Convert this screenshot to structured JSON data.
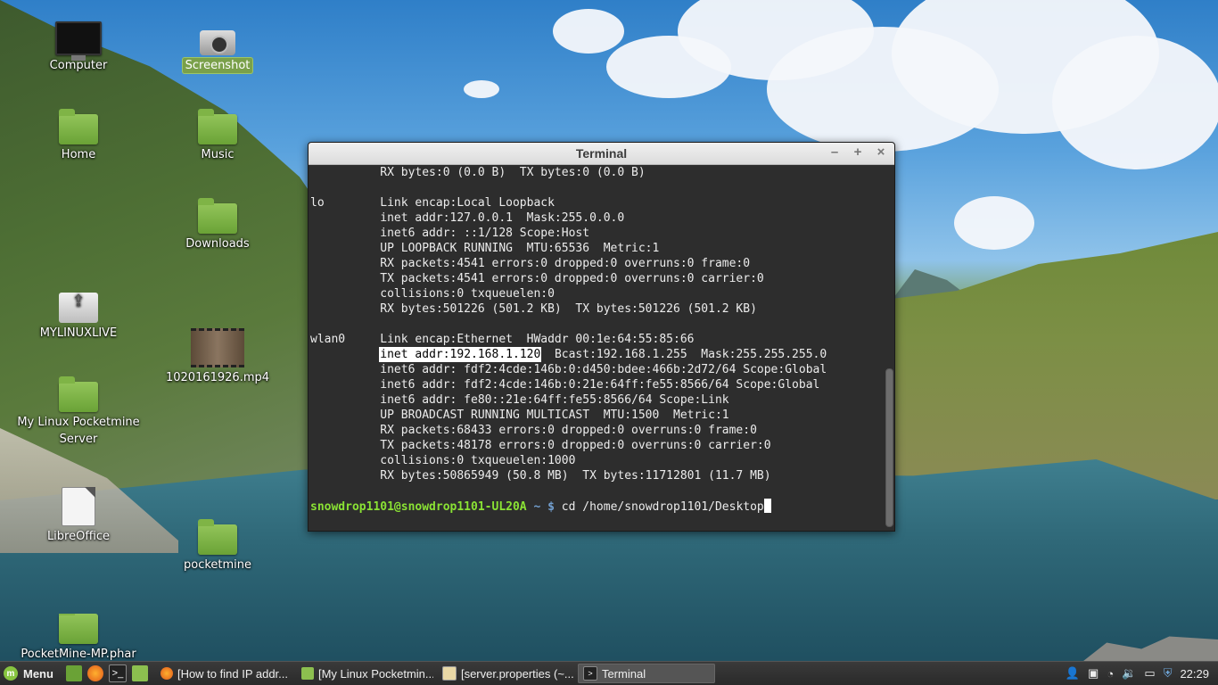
{
  "desktop": {
    "icons": [
      {
        "label": "Computer"
      },
      {
        "label": "Screenshot"
      },
      {
        "label": "Home"
      },
      {
        "label": "Music"
      },
      {
        "label": "Downloads"
      },
      {
        "label": "MYLINUXLIVE"
      },
      {
        "label": "1020161926.mp4"
      },
      {
        "label": "My Linux Pocketmine Server"
      },
      {
        "label": "LibreOffice"
      },
      {
        "label": "pocketmine"
      },
      {
        "label": "PocketMine-MP.phar"
      }
    ]
  },
  "terminal": {
    "title": "Terminal",
    "controls": {
      "minimize": "–",
      "maximize": "+",
      "close": "×"
    },
    "lines": [
      "          RX bytes:0 (0.0 B)  TX bytes:0 (0.0 B)",
      "",
      "lo        Link encap:Local Loopback",
      "          inet addr:127.0.0.1  Mask:255.0.0.0",
      "          inet6 addr: ::1/128 Scope:Host",
      "          UP LOOPBACK RUNNING  MTU:65536  Metric:1",
      "          RX packets:4541 errors:0 dropped:0 overruns:0 frame:0",
      "          TX packets:4541 errors:0 dropped:0 overruns:0 carrier:0",
      "          collisions:0 txqueuelen:0",
      "          RX bytes:501226 (501.2 KB)  TX bytes:501226 (501.2 KB)",
      "",
      "wlan0     Link encap:Ethernet  HWaddr 00:1e:64:55:85:66"
    ],
    "highlight_line": {
      "prefix": "          ",
      "highlight": "inet addr:192.168.1.120",
      "suffix": "  Bcast:192.168.1.255  Mask:255.255.255.0"
    },
    "lines_after": [
      "          inet6 addr: fdf2:4cde:146b:0:d450:bdee:466b:2d72/64 Scope:Global",
      "          inet6 addr: fdf2:4cde:146b:0:21e:64ff:fe55:8566/64 Scope:Global",
      "          inet6 addr: fe80::21e:64ff:fe55:8566/64 Scope:Link",
      "          UP BROADCAST RUNNING MULTICAST  MTU:1500  Metric:1",
      "          RX packets:68433 errors:0 dropped:0 overruns:0 frame:0",
      "          TX packets:48178 errors:0 dropped:0 overruns:0 carrier:0",
      "          collisions:0 txqueuelen:1000",
      "          RX bytes:50865949 (50.8 MB)  TX bytes:11712801 (11.7 MB)",
      ""
    ],
    "prompt": {
      "user_host": "snowdrop1101@snowdrop1101-UL20A",
      "path": "~",
      "symbol": "$",
      "command": "cd /home/snowdrop1101/Desktop"
    },
    "scroll_thumb": {
      "top": 0.56,
      "size": 0.44
    }
  },
  "taskbar": {
    "menu_label": "Menu",
    "quick_launch": [
      "show-desktop-icon",
      "firefox-icon",
      "terminal-icon",
      "files-icon"
    ],
    "tasks": [
      {
        "label": "[How to find IP addr...",
        "icon": "firefox-icon",
        "active": false
      },
      {
        "label": "[My Linux Pocketmin...",
        "icon": "folder-icon",
        "active": false
      },
      {
        "label": "[server.properties (~...",
        "icon": "text-editor-icon",
        "active": false
      },
      {
        "label": "Terminal",
        "icon": "terminal-icon",
        "active": true
      }
    ],
    "clock": "22:29",
    "accent_color": "#87c440"
  }
}
